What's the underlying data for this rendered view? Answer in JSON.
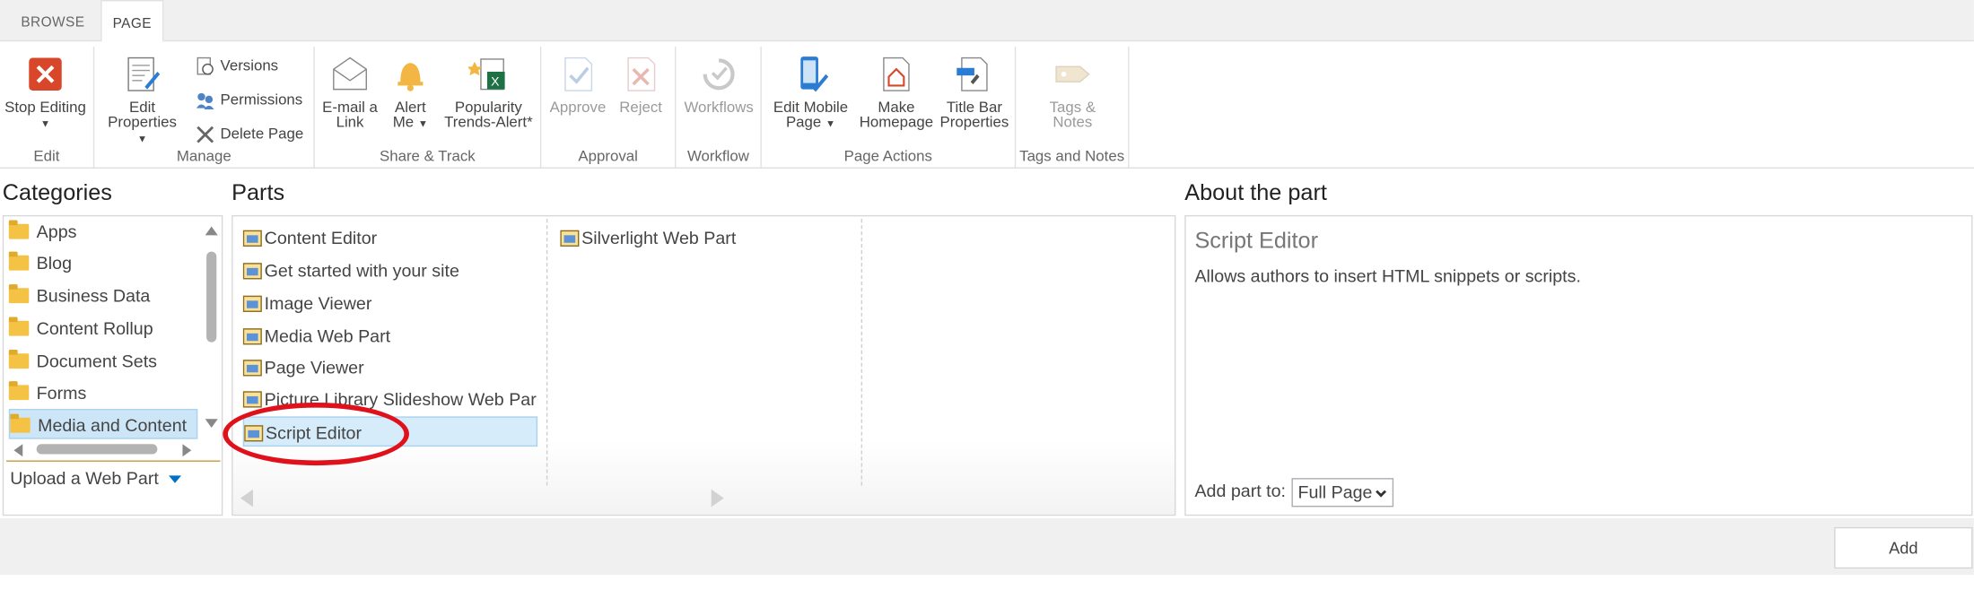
{
  "tabs": [
    {
      "label": "BROWSE"
    },
    {
      "label": "PAGE"
    }
  ],
  "ribbon": {
    "edit": {
      "group_label": "Edit",
      "stop_editing": {
        "label": "Stop Editing",
        "icon": "stop-editing-icon"
      }
    },
    "manage": {
      "group_label": "Manage",
      "edit_properties": {
        "label_line1": "Edit",
        "label_line2": "Properties"
      },
      "versions": "Versions",
      "permissions": "Permissions",
      "delete_page": "Delete Page"
    },
    "share_track": {
      "group_label": "Share & Track",
      "email_link": {
        "label_line1": "E-mail a",
        "label_line2": "Link"
      },
      "alert_me": {
        "label_line1": "Alert",
        "label_line2": "Me"
      },
      "popularity": {
        "label_line1": "Popularity",
        "label_line2": "Trends-Alert*"
      }
    },
    "approval": {
      "group_label": "Approval",
      "approve": "Approve",
      "reject": "Reject"
    },
    "workflow": {
      "group_label": "Workflow",
      "workflows": "Workflows"
    },
    "page_actions": {
      "group_label": "Page Actions",
      "edit_mobile": {
        "label_line1": "Edit Mobile",
        "label_line2": "Page"
      },
      "make_homepage": {
        "label_line1": "Make",
        "label_line2": "Homepage"
      },
      "title_bar": {
        "label_line1": "Title Bar",
        "label_line2": "Properties"
      }
    },
    "tags_notes": {
      "group_label": "Tags and Notes",
      "tags": {
        "label_line1": "Tags &",
        "label_line2": "Notes"
      }
    }
  },
  "categories": {
    "title": "Categories",
    "items": [
      "Apps",
      "Blog",
      "Business Data",
      "Content Rollup",
      "Document Sets",
      "Forms",
      "Media and Content"
    ],
    "selected": "Media and Content",
    "upload_label": "Upload a Web Part"
  },
  "parts": {
    "title": "Parts",
    "column1": [
      "Content Editor",
      "Get started with your site",
      "Image Viewer",
      "Media Web Part",
      "Page Viewer",
      "Picture Library Slideshow Web Par",
      "Script Editor"
    ],
    "column2": [
      "Silverlight Web Part"
    ],
    "selected": "Script Editor",
    "highlight_color": "#e0111b"
  },
  "about": {
    "title": "About the part",
    "part_name": "Script Editor",
    "description": "Allows authors to insert HTML snippets or scripts.",
    "add_part_to_label": "Add part to:",
    "add_part_to_value": "Full Page"
  },
  "add_button": "Add",
  "colors": {
    "accent": "#0072c6",
    "stop_red": "#d9472b",
    "selection": "#cde6f7"
  }
}
